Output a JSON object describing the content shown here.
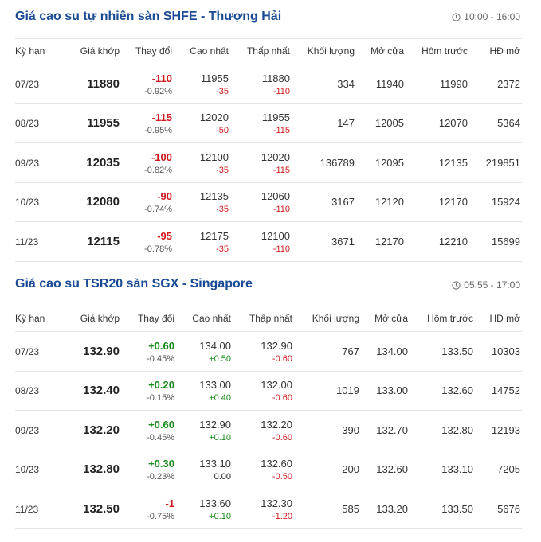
{
  "tables": [
    {
      "title": "Giá cao su tự nhiên sàn SHFE - Thượng Hải",
      "time": "10:00 - 16:00",
      "headers": [
        "Kỳ hạn",
        "Giá khớp",
        "Thay đổi",
        "Cao nhất",
        "Thấp nhất",
        "Khối lượng",
        "Mở cửa",
        "Hôm trước",
        "HĐ mở"
      ],
      "rows": [
        {
          "term": "07/23",
          "price": "11880",
          "change": "-110",
          "change_pct": "-0.92%",
          "high": "11955",
          "high_diff": "-35",
          "low": "11880",
          "low_diff": "-110",
          "volume": "334",
          "open": "11940",
          "prev": "11990",
          "oi": "2372"
        },
        {
          "term": "08/23",
          "price": "11955",
          "change": "-115",
          "change_pct": "-0.95%",
          "high": "12020",
          "high_diff": "-50",
          "low": "11955",
          "low_diff": "-115",
          "volume": "147",
          "open": "12005",
          "prev": "12070",
          "oi": "5364"
        },
        {
          "term": "09/23",
          "price": "12035",
          "change": "-100",
          "change_pct": "-0.82%",
          "high": "12100",
          "high_diff": "-35",
          "low": "12020",
          "low_diff": "-115",
          "volume": "136789",
          "open": "12095",
          "prev": "12135",
          "oi": "219851"
        },
        {
          "term": "10/23",
          "price": "12080",
          "change": "-90",
          "change_pct": "-0.74%",
          "high": "12135",
          "high_diff": "-35",
          "low": "12060",
          "low_diff": "-110",
          "volume": "3167",
          "open": "12120",
          "prev": "12170",
          "oi": "15924"
        },
        {
          "term": "11/23",
          "price": "12115",
          "change": "-95",
          "change_pct": "-0.78%",
          "high": "12175",
          "high_diff": "-35",
          "low": "12100",
          "low_diff": "-110",
          "volume": "3671",
          "open": "12170",
          "prev": "12210",
          "oi": "15699"
        }
      ]
    },
    {
      "title": "Giá cao su TSR20 sàn SGX - Singapore",
      "time": "05:55 - 17:00",
      "headers": [
        "Kỳ hạn",
        "Giá khớp",
        "Thay đổi",
        "Cao nhất",
        "Thấp nhất",
        "Khối lượng",
        "Mở cửa",
        "Hôm trước",
        "HĐ mở"
      ],
      "rows": [
        {
          "term": "07/23",
          "price": "132.90",
          "change": "+0.60",
          "change_pct": "-0.45%",
          "high": "134.00",
          "high_diff": "+0.50",
          "low": "132.90",
          "low_diff": "-0.60",
          "volume": "767",
          "open": "134.00",
          "prev": "133.50",
          "oi": "10303"
        },
        {
          "term": "08/23",
          "price": "132.40",
          "change": "+0.20",
          "change_pct": "-0.15%",
          "high": "133.00",
          "high_diff": "+0.40",
          "low": "132.00",
          "low_diff": "-0.60",
          "volume": "1019",
          "open": "133.00",
          "prev": "132.60",
          "oi": "14752"
        },
        {
          "term": "09/23",
          "price": "132.20",
          "change": "+0.60",
          "change_pct": "-0.45%",
          "high": "132.90",
          "high_diff": "+0.10",
          "low": "132.20",
          "low_diff": "-0.60",
          "volume": "390",
          "open": "132.70",
          "prev": "132.80",
          "oi": "12193"
        },
        {
          "term": "10/23",
          "price": "132.80",
          "change": "+0.30",
          "change_pct": "-0.23%",
          "high": "133.10",
          "high_diff": "0.00",
          "low": "132.60",
          "low_diff": "-0.50",
          "volume": "200",
          "open": "132.60",
          "prev": "133.10",
          "oi": "7205"
        },
        {
          "term": "11/23",
          "price": "132.50",
          "change": "-1",
          "change_pct": "-0.75%",
          "high": "133.60",
          "high_diff": "+0.10",
          "low": "132.30",
          "low_diff": "-1.20",
          "volume": "585",
          "open": "133.20",
          "prev": "133.50",
          "oi": "5676"
        }
      ]
    }
  ],
  "colors": {
    "title": "#1b4b94",
    "negative": "#d0191e",
    "positive": "#1a8a1a"
  },
  "icons": {
    "time": "clock-icon"
  }
}
